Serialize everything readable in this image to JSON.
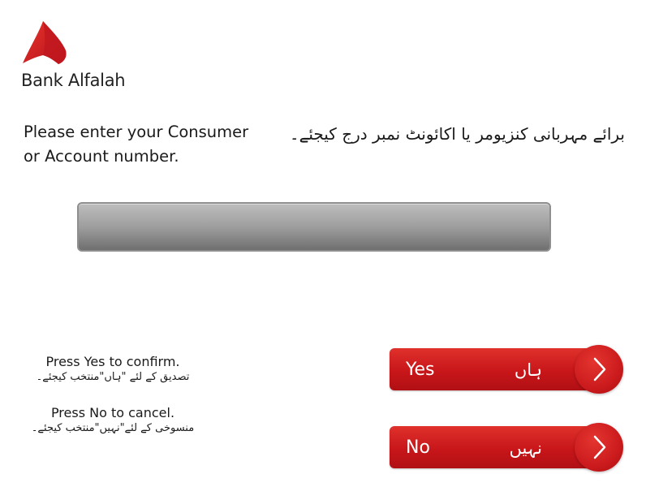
{
  "brand": {
    "name": "Bank Alfalah",
    "logo_icon": "alfalah-logo-icon",
    "accent_color": "#d71920"
  },
  "prompt": {
    "english": "Please enter your Consumer or Account number.",
    "urdu": "برائے مہربانی کنزیومر یا اکائونٹ نمبر درج کیجئے۔"
  },
  "entry_field": {
    "value": ""
  },
  "hints": {
    "yes_en": "Press Yes to confirm.",
    "yes_ur": "تصدیق کے لئے \"ہاں\"منتخب کیجئے۔",
    "no_en": "Press No to cancel.",
    "no_ur": "منسوخی کے لئے\"نہیں\"منتخب کیجئے۔"
  },
  "buttons": {
    "yes": {
      "label_en": "Yes",
      "label_ur": "ہاں",
      "icon": "chevron-right-icon"
    },
    "no": {
      "label_en": "No",
      "label_ur": "نہیں",
      "icon": "chevron-right-icon"
    }
  }
}
